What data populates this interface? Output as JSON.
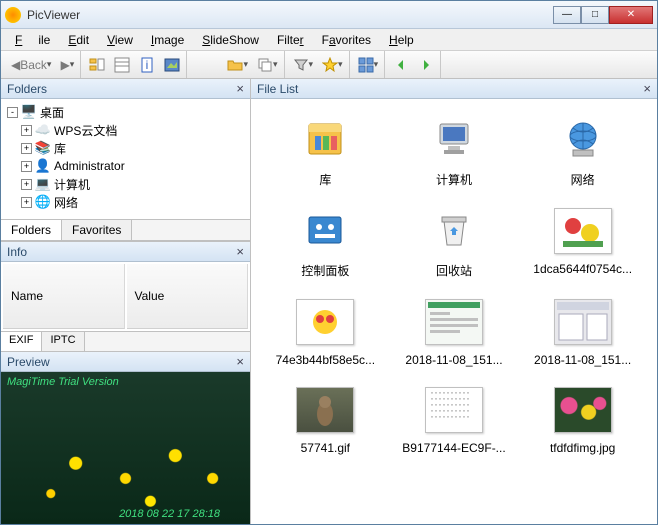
{
  "app": {
    "title": "PicViewer"
  },
  "menu": {
    "file": "File",
    "edit": "Edit",
    "view": "View",
    "image": "Image",
    "slideshow": "SlideShow",
    "filter": "Filter",
    "favorites": "Favorites",
    "help": "Help"
  },
  "toolbar": {
    "back": "Back"
  },
  "folders": {
    "title": "Folders",
    "items": [
      {
        "label": "桌面",
        "icon": "desktop",
        "exp": "-"
      },
      {
        "label": "WPS云文档",
        "icon": "cloud",
        "exp": "+",
        "indent": true
      },
      {
        "label": "库",
        "icon": "library",
        "exp": "+",
        "indent": true
      },
      {
        "label": "Administrator",
        "icon": "user",
        "exp": "+",
        "indent": true
      },
      {
        "label": "计算机",
        "icon": "computer",
        "exp": "+",
        "indent": true
      },
      {
        "label": "网络",
        "icon": "network",
        "exp": "+",
        "indent": true
      }
    ],
    "tabs": {
      "folders": "Folders",
      "favorites": "Favorites"
    }
  },
  "info": {
    "title": "Info",
    "col_name": "Name",
    "col_value": "Value",
    "tabs": {
      "exif": "EXIF",
      "iptc": "IPTC"
    }
  },
  "preview": {
    "title": "Preview",
    "watermark": "MagiTime Trial Version",
    "timestamp": "2018 08 22 17 28:18"
  },
  "filelist": {
    "title": "File List",
    "items": [
      {
        "label": "库",
        "kind": "library"
      },
      {
        "label": "计算机",
        "kind": "computer"
      },
      {
        "label": "网络",
        "kind": "network"
      },
      {
        "label": "控制面板",
        "kind": "cpanel"
      },
      {
        "label": "回收站",
        "kind": "recycle"
      },
      {
        "label": "1dca5644f0754c...",
        "kind": "image1"
      },
      {
        "label": "74e3b44bf58e5c...",
        "kind": "image2"
      },
      {
        "label": "2018-11-08_151...",
        "kind": "screenshot1"
      },
      {
        "label": "2018-11-08_151...",
        "kind": "screenshot2"
      },
      {
        "label": "57741.gif",
        "kind": "image3"
      },
      {
        "label": "B9177144-EC9F-...",
        "kind": "image4"
      },
      {
        "label": "tfdfdfimg.jpg",
        "kind": "image5"
      }
    ]
  }
}
